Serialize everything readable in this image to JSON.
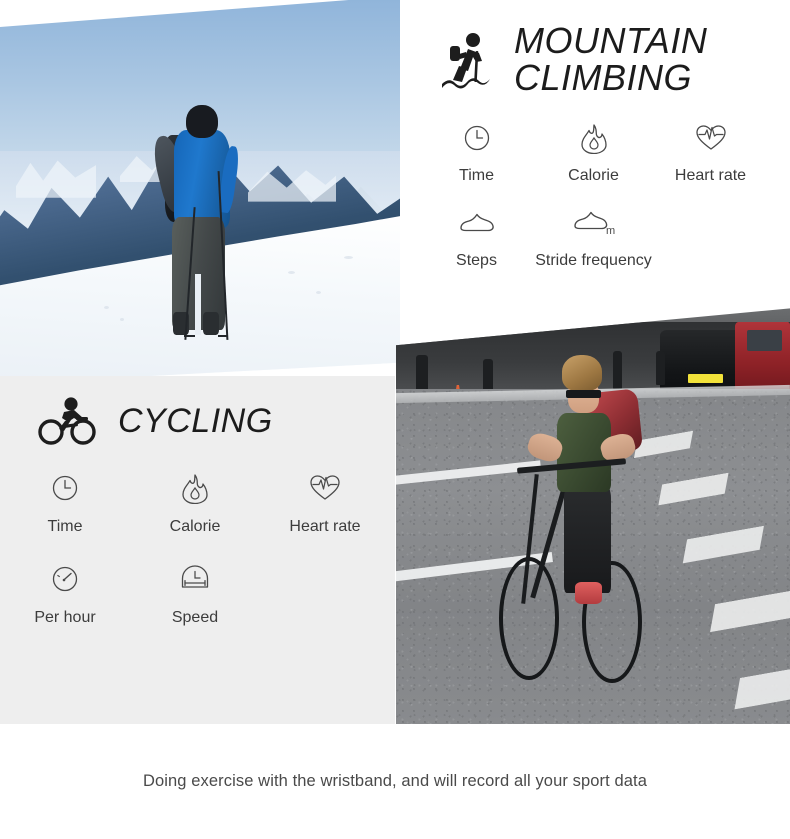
{
  "sections": {
    "climbing": {
      "title_line1": "MOUNTAIN",
      "title_line2": "CLIMBING",
      "icon": "hiker-icon",
      "features": [
        {
          "icon": "clock-icon",
          "label": "Time"
        },
        {
          "icon": "flame-icon",
          "label": "Calorie"
        },
        {
          "icon": "heart-rate-icon",
          "label": "Heart rate"
        },
        {
          "icon": "shoe-icon",
          "label": "Steps"
        },
        {
          "icon": "shoe-meter-icon",
          "label": "Stride frequency"
        }
      ]
    },
    "cycling": {
      "title": "CYCLING",
      "icon": "cyclist-icon",
      "features": [
        {
          "icon": "clock-icon",
          "label": "Time"
        },
        {
          "icon": "flame-icon",
          "label": "Calorie"
        },
        {
          "icon": "heart-rate-icon",
          "label": "Heart rate"
        },
        {
          "icon": "gauge-icon",
          "label": "Per hour"
        },
        {
          "icon": "speed-icon",
          "label": "Speed"
        }
      ]
    }
  },
  "photos": {
    "mountain": "snow-mountain-hiker-photo",
    "cycling": "city-street-cyclist-photo"
  },
  "footer": {
    "caption": "Doing exercise with the wristband, and will record all your sport data"
  },
  "colors": {
    "panel_background": "#eeeeee",
    "page_background": "#ffffff",
    "title_text": "#1c1c1c",
    "label_text": "#3c3c3c",
    "caption_text": "#4a4a4a",
    "icon_stroke": "#4a4a4a"
  }
}
